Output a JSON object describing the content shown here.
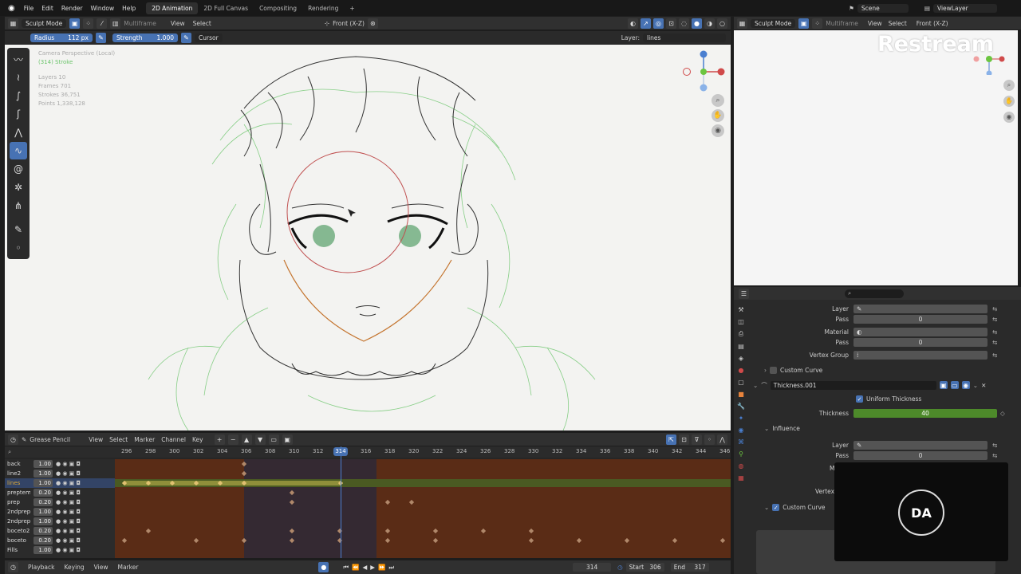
{
  "topbar": {
    "menus": [
      "File",
      "Edit",
      "Render",
      "Window",
      "Help"
    ],
    "tabs": [
      "2D Animation",
      "2D Full Canvas",
      "Compositing",
      "Rendering"
    ],
    "add": "+",
    "scene": "Scene",
    "view_layer": "ViewLayer"
  },
  "viewport_header": {
    "mode": "Sculpt Mode",
    "multiframe": "Multiframe",
    "view": "View",
    "select": "Select",
    "orientation": "Front (X-Z)",
    "radius_label": "Radius",
    "radius_value": "112 px",
    "strength_label": "Strength",
    "strength_value": "1.000",
    "cursor": "Cursor",
    "layer_label": "Layer:",
    "layer_value": "lines"
  },
  "overlay": {
    "camera": "Camera Perspective (Local)",
    "object": "(314) Stroke",
    "layers": "Layers 10",
    "frames": "Frames 701",
    "strokes": "Strokes 36,751",
    "points": "Points 1,338,128"
  },
  "right_header": {
    "mode": "Sculpt Mode",
    "multiframe": "Multiframe",
    "view": "View",
    "select": "Select",
    "orientation": "Front (X-Z)"
  },
  "restream": "Restream",
  "properties": {
    "layer": "Layer",
    "pass": "Pass",
    "pass_value": "0",
    "material": "Material",
    "pass2": "Pass",
    "pass2_value": "0",
    "vertex_group": "Vertex Group",
    "custom_curve": "Custom Curve",
    "modifier_name": "Thickness.001",
    "uniform": "Uniform Thickness",
    "thickness": "Thickness",
    "thickness_value": "40",
    "influence": "Influence",
    "layer2": "Layer",
    "pass3": "Pass",
    "pass3_value": "0",
    "m": "M",
    "vertex2": "Vertex",
    "custom_curve2": "Custom Curve"
  },
  "avatar": "DA",
  "dopesheet": {
    "editor": "Grease Pencil",
    "view": "View",
    "select": "Select",
    "marker": "Marker",
    "channel": "Channel",
    "key": "Key",
    "frames": [
      "296",
      "298",
      "300",
      "302",
      "304",
      "306",
      "308",
      "310",
      "312",
      "314",
      "316",
      "318",
      "320",
      "322",
      "324",
      "326",
      "328",
      "330",
      "332",
      "334",
      "336",
      "338",
      "340",
      "342",
      "344",
      "346"
    ],
    "current": "314",
    "channels": [
      {
        "name": "back",
        "op": "1.00"
      },
      {
        "name": "line2",
        "op": "1.00"
      },
      {
        "name": "lines",
        "op": "1.00"
      },
      {
        "name": "preptemp",
        "op": "0.20"
      },
      {
        "name": "prep",
        "op": "0.20"
      },
      {
        "name": "2ndprepter",
        "op": "1.00"
      },
      {
        "name": "2ndprep",
        "op": "1.00"
      },
      {
        "name": "boceto2",
        "op": "0.20"
      },
      {
        "name": "boceto",
        "op": "0.20"
      },
      {
        "name": "Fills",
        "op": "1.00"
      }
    ]
  },
  "bottombar": {
    "playback": "Playback",
    "keying": "Keying",
    "view": "View",
    "marker": "Marker",
    "frame": "314",
    "start_label": "Start",
    "start": "306",
    "end_label": "End",
    "end": "317"
  },
  "colors": {
    "accent": "#4772b3",
    "active_layer": "#d9a83a",
    "thickness_bar": "#4d8a2a",
    "keyframe_band": "#5a2c16"
  }
}
